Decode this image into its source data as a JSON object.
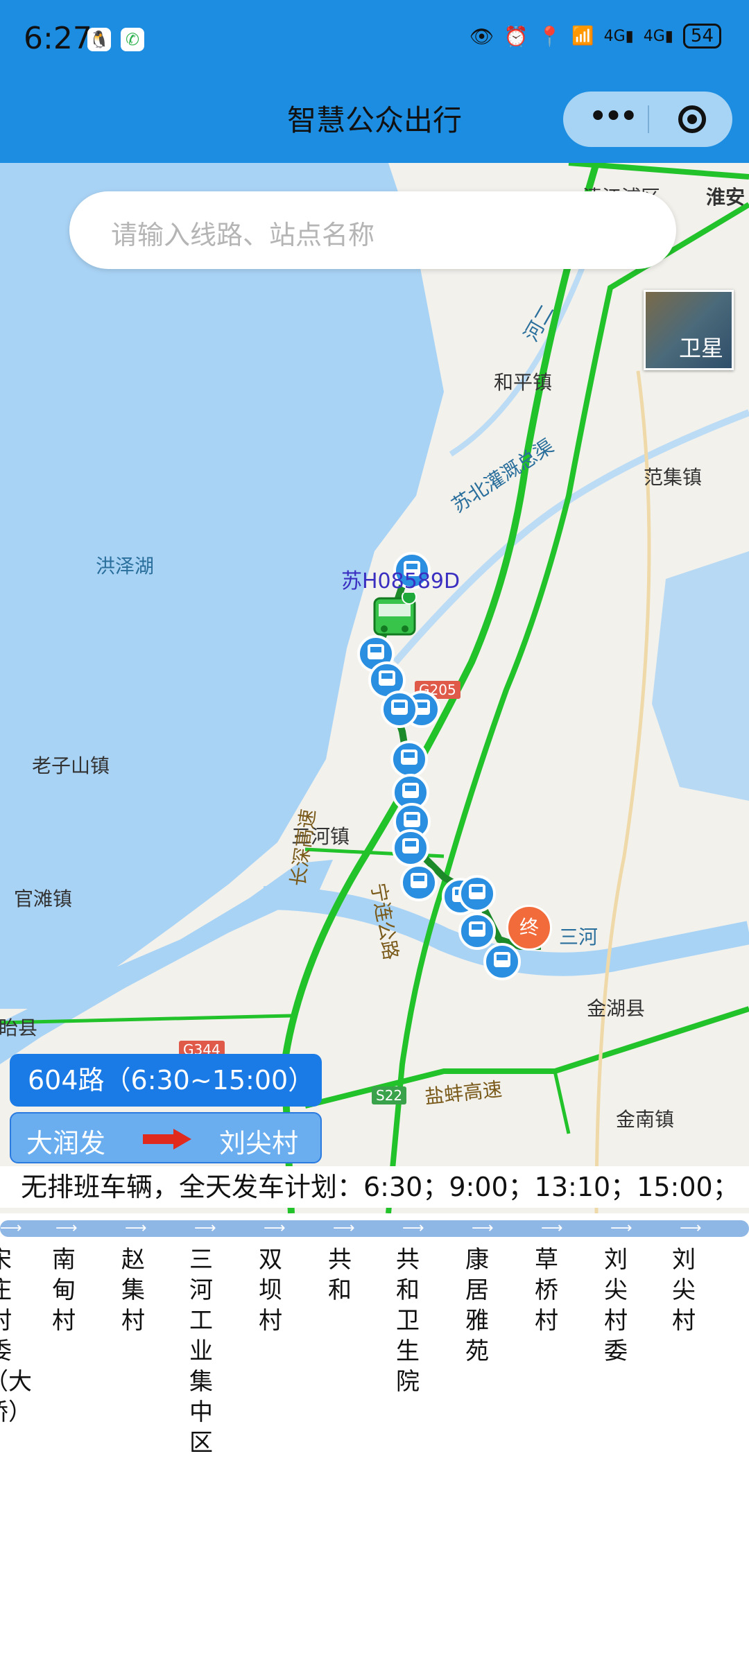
{
  "status_bar": {
    "time": "6:27",
    "battery": "54",
    "icons": [
      "qq-icon",
      "phone-icon",
      "eye-icon",
      "alarm-icon",
      "location-icon",
      "wifi-icon",
      "signal-4g-icon",
      "signal-4g-icon",
      "battery-icon"
    ]
  },
  "header": {
    "title": "智慧公众出行"
  },
  "search": {
    "placeholder": "请输入线路、站点名称"
  },
  "map": {
    "satellite_label": "卫星",
    "labels": {
      "qingjiangpu": "清江浦区",
      "huaian": "淮安",
      "heping": "和平镇",
      "fanji": "范集镇",
      "canal": "苏北灌溉总渠",
      "river": "河二",
      "hongze": "洪泽湖",
      "laozishan": "老子山镇",
      "sanhe": "三河镇",
      "guantan": "官滩镇",
      "jinhu": "金湖县",
      "jinnan": "金南镇",
      "yi": "盱眙县",
      "sanhe_river": "三河",
      "changshen": "长深高速",
      "ninglian": "宁连公路",
      "yanbeng": "盐蚌高速",
      "g205": "G205",
      "g344": "G344",
      "s22": "S22",
      "end_marker": "终"
    },
    "bus_plate": "苏H08589D"
  },
  "route": {
    "name": "604路（6:30~15:00）",
    "from": "大润发",
    "to": "刘尖村"
  },
  "notice": "无排班车辆，全天发车计划：6:30；9:00；13:10；15:00；",
  "stops": [
    "宋庄村委（大桥）",
    "南甸村",
    "赵集村",
    "三河工业集中区",
    "双坝村",
    "共和",
    "共和卫生院",
    "康居雅苑",
    "草桥村",
    "刘尖村委",
    "刘尖村"
  ],
  "colors": {
    "topbar": "#1c8de0",
    "route_box": "#1a7be6",
    "direction_box": "#6aaef0",
    "road_green": "#22c22a",
    "water": "#a9d3f5",
    "end_marker": "#f26b3a"
  }
}
